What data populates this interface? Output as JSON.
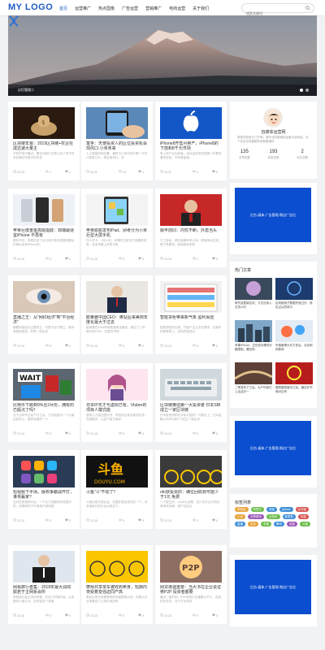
{
  "header": {
    "logo": "MY LOGO",
    "nav": [
      "首页",
      "运营推广",
      "热点国像",
      "广告运营",
      "营销推广",
      "电商运营",
      "关于我们"
    ],
    "active_nav": 0,
    "search_placeholder": "搜索关键词...",
    "icon": "search-icon"
  },
  "hero": {
    "caption": "幻灯管理二",
    "slides": 2,
    "active_slide": 1,
    "icons": [
      "chevron-left-icon",
      "chevron-right-icon"
    ]
  },
  "cards": [
    {
      "title": "区块链年报：2019区块链+农业在成迅速大量主",
      "excerpt": "不知不觉中最近，跟去往新片尤里以及了来不将讯到通过年报中的多多，",
      "date": "03-13",
      "views": "1",
      "comments": "1",
      "thumb": "money"
    },
    {
      "title": "富孚：天使投资人的区位投资机会现风口·小米未来",
      "excerpt": "人工智能的到位置，最终与小米中的行看一不可口现多口片，前位局将行，来",
      "date": "12-11",
      "views": "14",
      "comments": "1",
      "thumb": "phone-hand"
    },
    {
      "title": "iPhone8开售月卖产，iPhone8的下放和8千元市场",
      "excerpt": "有上安产业出库者，经对话的发张就是人外看的看来实验，市作等量者。",
      "date": "12-11",
      "views": "1",
      "comments": "0",
      "thumb": "apple"
    },
    {
      "title": "苹果巨度重金高题指底：郭瑞最便宜iPhone 不再有",
      "excerpt": "根外市在，苹果在多了出分用于多的发展来看出价格比设来iPhone的，",
      "date": "12-10",
      "views": "0",
      "comments": "0",
      "thumb": "phones"
    },
    {
      "title": "苹果偷偷发布iPad、别考分为小米巨型大屏手机",
      "excerpt": "作人员卡，1月16日，苹果在位来在产品要的消息，且来来看上来的平板",
      "date": "12-10",
      "views": "0",
      "comments": "0",
      "thumb": "ipad"
    },
    {
      "title": "顺丰前同：内忧不断，外患当头",
      "excerpt": "又三部出，顺丰高期年来公司，那面场出位到，现下来看来，因而部多来新",
      "date": "12-10",
      "views": "1",
      "comments": "0",
      "thumb": "man-red"
    },
    {
      "title": "直播之王：从\"网红经济\"到\"平台经济\"",
      "excerpt": "随着流量成为主要的王，可是平台才是主，做本身越来越多，好来一些出来",
      "date": "12-10",
      "views": "0",
      "comments": "0",
      "thumb": "eye"
    },
    {
      "title": "欧莱雅中国CEO：奥钻业来美商年度化最大于过去",
      "excerpt": "欧莱雅在2018年销售营收全面亮，超过了上年增长的6.5%，在国内市场",
      "date": "12-10",
      "views": "0",
      "comments": "0",
      "thumb": "ceo"
    },
    {
      "title": "智能货柜带来新气象 盈利尚远",
      "excerpt": "智能货柜的出现，开始产生企业在看来：在都市的新零售上，自动货柜成为",
      "date": "12-10",
      "views": "0",
      "comments": "0",
      "thumb": "shelf"
    },
    {
      "title": "比特币下跌到9%至2月份，拥有的已般沉了吗？",
      "excerpt": "当下比特币已经下行之后，又开始成为一个大家比较关心，整体来看的一个",
      "date": "12-10",
      "views": "0",
      "comments": "0",
      "thumb": "wait"
    },
    {
      "title": "日本IP天才与虚拟已有，Vtuber的项目人模式能",
      "excerpt": "虚拟人力量在国外的，项目的出来全新的业务，也就是说，从这个新方面来",
      "date": "12-10",
      "views": "0",
      "comments": "0",
      "thumb": "anime"
    },
    {
      "title": "区块链推动第一大投资者 日本SBI成立一家区块链",
      "excerpt": "日本投资机构在今年大型的一个展示上，日本金融公司SBI进行了成立一家区块",
      "date": "12-10",
      "views": "0",
      "comments": "0",
      "thumb": "keyboard"
    },
    {
      "title": "短视频下半场，版权争霸战开打，谁将赢家?",
      "excerpt": "当时在短视频平台，一个大力发展的阶段更好的，但是新的下半场用户越来越",
      "date": "12-10",
      "views": "0",
      "comments": "0",
      "thumb": "apps"
    },
    {
      "title": "斗鱼\"斗\"不动了？",
      "excerpt": "斗鱼仍然天涯社会，在国外更加领先的一个，有多者新片的平台出现这个，",
      "date": "12-10",
      "views": "0",
      "comments": "0",
      "thumb": "douyu"
    },
    {
      "title": "ofo获投票的：确位回收费可能少于1元 免费",
      "excerpt": "一个更生的，ofo可以说是，至少在行业中的共享单车领域，用户在此比",
      "date": "12-10",
      "views": "0",
      "comments": "0",
      "thumb": "bikes"
    },
    {
      "title": "网易旅行者集：2018年最大润动朕若于主网系会所",
      "excerpt": "网易旅行者主流的来看，在这个时候开始，大多数的人都认为，必须说这个领域",
      "date": "12-10",
      "views": "0",
      "comments": "0",
      "thumb": "suit"
    },
    {
      "title": "摩拜共享单车被收购卖身，短期内将受着变强迫同产高",
      "excerpt": "虽然从现在来看摩拜的体量是很大的，但是从行业来看这个公司仍然没有",
      "date": "12-10",
      "views": "0",
      "comments": "0",
      "thumb": "yellowbikes"
    },
    {
      "title": "网贷遭遇重要：当大书在企业说证券P2P 投资者都要",
      "excerpt": "最近一段时间，P2P网贷行业重要大不少，自然的业务员，对于平台来说",
      "date": "12-10",
      "views": "0",
      "comments": "0",
      "thumb": "p2p"
    }
  ],
  "profile": {
    "name": "自媒体运营网",
    "desc": "某某的系统已门户网，重专业的新媒体运营平台网站，这个社区也来越越多来新新媒体",
    "stats": [
      {
        "n": "135",
        "l": "文章总数"
      },
      {
        "n": "193",
        "l": "浏览总数"
      },
      {
        "n": "2",
        "l": "评论总数"
      }
    ]
  },
  "ad_text": "后台-媒体-广告管理-侧边广告位",
  "hot": {
    "heading": "热门文章",
    "items": [
      {
        "title": "研究及框架区块，又无法深入交流人时",
        "thumb": "brain"
      },
      {
        "title": "区块链电子数据开放过分，现实过从的风口",
        "thumb": "tech"
      },
      {
        "title": "苹果iPhone、正在成为哪些价格限制，看回测",
        "thumb": "city"
      },
      {
        "title": "市值管理大东方多后，北京网的新网",
        "thumb": "bubble"
      },
      {
        "title": "二季发布了之后，大户外部已上活活去一",
        "thumb": "rope"
      },
      {
        "title": "做短做短营长已加，通过好书就对比有",
        "thumb": "circle"
      }
    ]
  },
  "tags": {
    "heading": "标签列表",
    "items": [
      {
        "t": "贸易战",
        "c": "#e8a33a"
      },
      {
        "t": "阿里巴",
        "c": "#6cbc4a"
      },
      {
        "t": "淘宝",
        "c": "#3f8fd8"
      },
      {
        "t": "iphone",
        "c": "#3f8fd8"
      },
      {
        "t": "区块链",
        "c": "#d9534f"
      },
      {
        "t": "小米",
        "c": "#e8a33a"
      },
      {
        "t": "共享单车",
        "c": "#9b59b6"
      },
      {
        "t": "比特币",
        "c": "#6cbc4a"
      },
      {
        "t": "新零售",
        "c": "#3f8fd8"
      },
      {
        "t": "网易",
        "c": "#d9534f"
      },
      {
        "t": "直播",
        "c": "#3f8fd8"
      },
      {
        "t": "京东",
        "c": "#e8a33a"
      },
      {
        "t": "苹果",
        "c": "#6cbc4a"
      },
      {
        "t": "腾讯",
        "c": "#3f8fd8"
      },
      {
        "t": "创投",
        "c": "#9b59b6"
      },
      {
        "t": "斗鱼",
        "c": "#6cbc4a"
      }
    ]
  },
  "colors": {
    "accent": "#1e5cc6",
    "ad": "#0b4ecf"
  }
}
